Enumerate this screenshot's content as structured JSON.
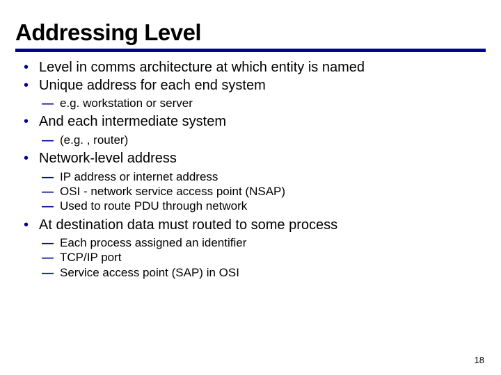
{
  "title": "Addressing Level",
  "bullets": [
    {
      "text": "Level in comms architecture at which entity is named",
      "sub": []
    },
    {
      "text": "Unique address for each end system",
      "sub": [
        "e.g. workstation or server"
      ]
    },
    {
      "text": "And each intermediate system",
      "sub": [
        "(e.g. , router)"
      ]
    },
    {
      "text": "Network-level address",
      "sub": [
        "IP address or internet address",
        "OSI - network service access point (NSAP)",
        "Used to route PDU through network"
      ]
    },
    {
      "text": "At destination data must routed to some process",
      "sub": [
        "Each process assigned an identifier",
        "TCP/IP port",
        "Service access point (SAP) in OSI"
      ]
    }
  ],
  "page_number": "18"
}
